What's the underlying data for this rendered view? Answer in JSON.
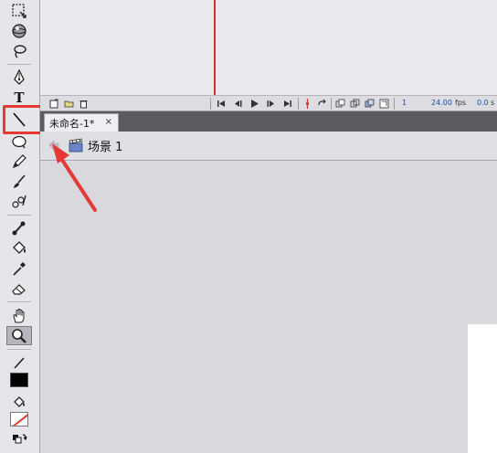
{
  "document": {
    "tab_title": "未命名-1*",
    "tab_close": "×"
  },
  "edit_bar": {
    "scene_label": "场景 1"
  },
  "timeline": {
    "current_frame": "1",
    "fps_value": "24.00",
    "fps_unit": "fps",
    "time_value": "0.0",
    "time_unit": "s"
  },
  "toolbar": {
    "tools": [
      "free-transform-tool",
      "3d-rotation-tool",
      "lasso-tool",
      "pen-tool",
      "text-tool",
      "line-tool",
      "oval-tool",
      "pencil-tool",
      "brush-tool",
      "deco-tool",
      "bone-tool",
      "paint-bucket-tool",
      "eyedropper-tool",
      "eraser-tool",
      "hand-tool",
      "zoom-tool"
    ],
    "text_tool_glyph": "T",
    "selected_tool": "line-tool",
    "stroke_color": "#000000",
    "fill_color": "none"
  },
  "annotation": {
    "color": "#e53935"
  }
}
